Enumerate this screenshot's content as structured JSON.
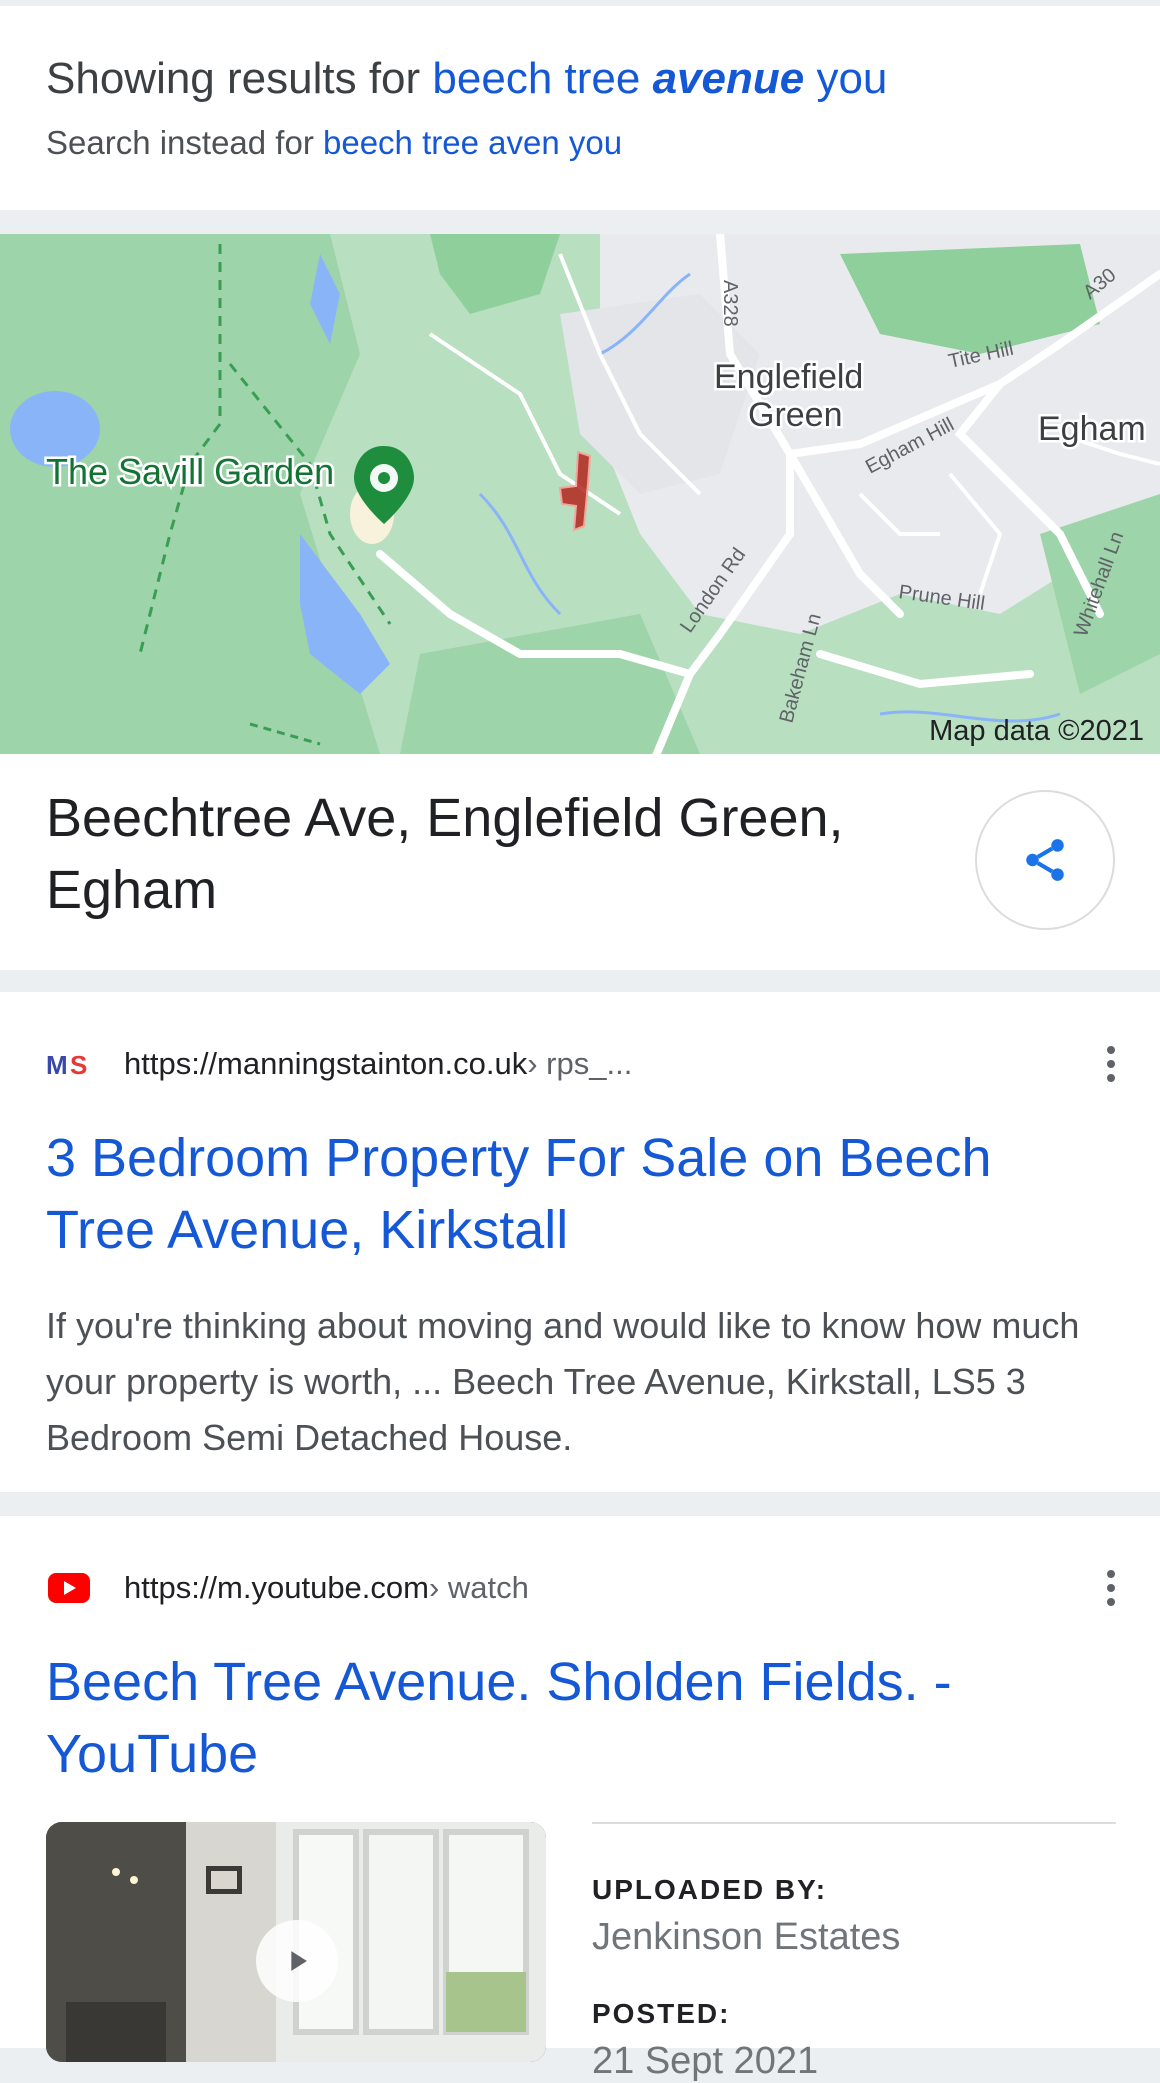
{
  "did_you_mean": {
    "showing_prefix": "Showing results for",
    "query_part1": "beech tree",
    "query_corrected": "avenue",
    "query_part2": "you",
    "instead_prefix": "Search instead for",
    "original_query": "beech tree aven you"
  },
  "map": {
    "labels": {
      "savill": "The Savill Garden",
      "englefield": "Englefield",
      "green": "Green",
      "egham": "Egham",
      "a328": "A328",
      "a30": "A30",
      "tite_hill": "Tite Hill",
      "egham_hill": "Egham Hill",
      "london_rd": "London Rd",
      "prune_hill": "Prune Hill",
      "bakeham_ln": "Bakeham Ln",
      "whitehall_ln": "Whitehall Ln"
    },
    "attribution": "Map data ©2021",
    "place_title": "Beechtree Ave, Englefield Green, Egham"
  },
  "results": [
    {
      "favicon": "manning-stainton-logo",
      "url": "https://manningstainton.co.uk",
      "crumb": " › rps_...",
      "title": "3 Bedroom Property For Sale on Beech Tree Avenue, Kirkstall",
      "snippet": "If you're thinking about moving and would like to know how much your property is worth, ... Beech Tree Avenue, Kirkstall, LS5 3 Bedroom Semi Detached House."
    },
    {
      "favicon": "youtube-logo",
      "url": "https://m.youtube.com",
      "crumb": " › watch",
      "title": "Beech Tree Avenue. Sholden Fields. - YouTube",
      "uploaded_label": "UPLOADED BY:",
      "uploaded_value": "Jenkinson Estates",
      "posted_label": "POSTED:",
      "posted_value": "21 Sept 2021"
    }
  ],
  "colors": {
    "link": "#1558d6",
    "map_green": "#a8dab5",
    "map_grey": "#e8eaed"
  }
}
